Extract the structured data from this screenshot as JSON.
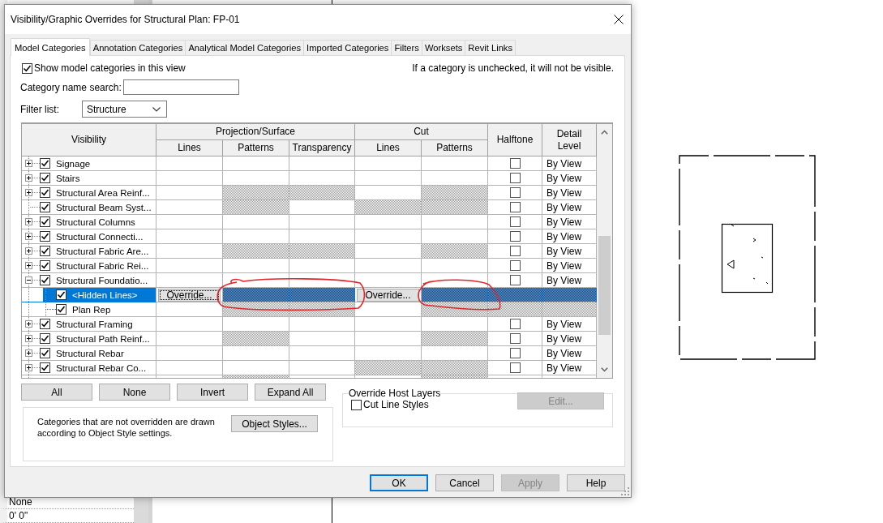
{
  "app": {
    "properties": [
      "None",
      "0' 0\""
    ]
  },
  "dialog": {
    "title": "Visibility/Graphic Overrides for Structural Plan: FP-01"
  },
  "tabs": [
    {
      "label": "Model Categories",
      "selected": true
    },
    {
      "label": "Annotation Categories",
      "selected": false
    },
    {
      "label": "Analytical Model Categories",
      "selected": false
    },
    {
      "label": "Imported Categories",
      "selected": false
    },
    {
      "label": "Filters",
      "selected": false
    },
    {
      "label": "Worksets",
      "selected": false
    },
    {
      "label": "Revit Links",
      "selected": false
    }
  ],
  "show_categories": {
    "label": "Show model categories in this view",
    "checked": true
  },
  "hint": "If a category is unchecked, it will not be visible.",
  "search": {
    "label": "Category name search:"
  },
  "filter_list": {
    "label": "Filter list:",
    "value": "Structure"
  },
  "table": {
    "visibility_header": "Visibility",
    "groups": [
      {
        "label": "Projection/Surface",
        "columns": [
          "Lines",
          "Patterns",
          "Transparency"
        ]
      },
      {
        "label": "Cut",
        "columns": [
          "Lines",
          "Patterns"
        ]
      }
    ],
    "halftone_header": "Halftone",
    "detail_header": "Detail Level",
    "rows": [
      {
        "name": "Signage",
        "checked": true,
        "expanded": false,
        "selected": false,
        "cells": [
          {
            "kind": "empty"
          },
          {
            "kind": "empty"
          },
          {
            "kind": "empty"
          },
          {
            "kind": "empty"
          },
          {
            "kind": "empty"
          }
        ],
        "halftone": {
          "kind": "checkbox",
          "checked": false
        },
        "detail": {
          "kind": "text",
          "text": "By View"
        }
      },
      {
        "name": "Stairs",
        "checked": true,
        "expanded": false,
        "selected": false,
        "cells": [
          {
            "kind": "empty"
          },
          {
            "kind": "empty"
          },
          {
            "kind": "empty"
          },
          {
            "kind": "empty"
          },
          {
            "kind": "empty"
          }
        ],
        "halftone": {
          "kind": "checkbox",
          "checked": false
        },
        "detail": {
          "kind": "text",
          "text": "By View"
        }
      },
      {
        "name": "Structural Area Reinf...",
        "checked": true,
        "expanded": false,
        "selected": false,
        "cells": [
          {
            "kind": "empty"
          },
          {
            "kind": "hatched"
          },
          {
            "kind": "hatched"
          },
          {
            "kind": "empty"
          },
          {
            "kind": "hatched"
          }
        ],
        "halftone": {
          "kind": "checkbox",
          "checked": false
        },
        "detail": {
          "kind": "text",
          "text": "By View"
        }
      },
      {
        "name": "Structural Beam Syst...",
        "checked": true,
        "selected": false,
        "cells": [
          {
            "kind": "empty"
          },
          {
            "kind": "hatched"
          },
          {
            "kind": "empty"
          },
          {
            "kind": "hatched"
          },
          {
            "kind": "hatched"
          }
        ],
        "halftone": {
          "kind": "checkbox",
          "checked": false
        },
        "detail": {
          "kind": "text",
          "text": "By View"
        }
      },
      {
        "name": "Structural Columns",
        "checked": true,
        "expanded": false,
        "selected": false,
        "cells": [
          {
            "kind": "empty"
          },
          {
            "kind": "empty"
          },
          {
            "kind": "empty"
          },
          {
            "kind": "empty"
          },
          {
            "kind": "empty"
          }
        ],
        "halftone": {
          "kind": "checkbox",
          "checked": false
        },
        "detail": {
          "kind": "text",
          "text": "By View"
        }
      },
      {
        "name": "Structural Connecti...",
        "checked": true,
        "expanded": false,
        "selected": false,
        "cells": [
          {
            "kind": "empty"
          },
          {
            "kind": "empty"
          },
          {
            "kind": "empty"
          },
          {
            "kind": "empty"
          },
          {
            "kind": "empty"
          }
        ],
        "halftone": {
          "kind": "checkbox",
          "checked": false
        },
        "detail": {
          "kind": "text",
          "text": "By View"
        }
      },
      {
        "name": "Structural Fabric Are...",
        "checked": true,
        "expanded": false,
        "selected": false,
        "cells": [
          {
            "kind": "empty"
          },
          {
            "kind": "hatched"
          },
          {
            "kind": "hatched"
          },
          {
            "kind": "empty"
          },
          {
            "kind": "hatched"
          }
        ],
        "halftone": {
          "kind": "checkbox",
          "checked": false
        },
        "detail": {
          "kind": "text",
          "text": "By View"
        }
      },
      {
        "name": "Structural Fabric Rei...",
        "checked": true,
        "expanded": false,
        "selected": false,
        "cells": [
          {
            "kind": "empty"
          },
          {
            "kind": "empty"
          },
          {
            "kind": "empty"
          },
          {
            "kind": "empty"
          },
          {
            "kind": "empty"
          }
        ],
        "halftone": {
          "kind": "checkbox",
          "checked": false
        },
        "detail": {
          "kind": "text",
          "text": "By View"
        }
      },
      {
        "name": "Structural Foundatio...",
        "checked": true,
        "expanded": true,
        "selected": false,
        "cells": [
          {
            "kind": "empty"
          },
          {
            "kind": "empty"
          },
          {
            "kind": "empty"
          },
          {
            "kind": "empty"
          },
          {
            "kind": "empty"
          }
        ],
        "halftone": {
          "kind": "checkbox",
          "checked": false
        },
        "detail": {
          "kind": "text",
          "text": "By View"
        },
        "children": [
          {
            "name": "<Hidden Lines>",
            "checked": true,
            "selected": true,
            "cells": [
              {
                "kind": "button",
                "label": "Override...",
                "focused": true
              },
              {
                "kind": "hatched"
              },
              {
                "kind": "hatched"
              },
              {
                "kind": "button",
                "label": "Override...",
                "focused": false
              },
              {
                "kind": "hatched"
              }
            ],
            "halftone": {
              "kind": "hatched"
            },
            "detail": {
              "kind": "hatched"
            }
          },
          {
            "name": "Plan Rep",
            "checked": true,
            "selected": false,
            "cells": [
              {
                "kind": "empty"
              },
              {
                "kind": "hatched"
              },
              {
                "kind": "hatched"
              },
              {
                "kind": "empty"
              },
              {
                "kind": "hatched"
              }
            ],
            "halftone": {
              "kind": "hatched"
            },
            "detail": {
              "kind": "hatched"
            }
          }
        ]
      },
      {
        "name": "Structural Framing",
        "checked": true,
        "expanded": false,
        "selected": false,
        "cells": [
          {
            "kind": "empty"
          },
          {
            "kind": "empty"
          },
          {
            "kind": "empty"
          },
          {
            "kind": "empty"
          },
          {
            "kind": "empty"
          }
        ],
        "halftone": {
          "kind": "checkbox",
          "checked": false
        },
        "detail": {
          "kind": "text",
          "text": "By View"
        }
      },
      {
        "name": "Structural Path Reinf...",
        "checked": true,
        "expanded": false,
        "selected": false,
        "cells": [
          {
            "kind": "empty"
          },
          {
            "kind": "hatched"
          },
          {
            "kind": "empty"
          },
          {
            "kind": "empty"
          },
          {
            "kind": "hatched"
          }
        ],
        "halftone": {
          "kind": "checkbox",
          "checked": false
        },
        "detail": {
          "kind": "text",
          "text": "By View"
        }
      },
      {
        "name": "Structural Rebar",
        "checked": true,
        "expanded": false,
        "selected": false,
        "cells": [
          {
            "kind": "empty"
          },
          {
            "kind": "empty"
          },
          {
            "kind": "empty"
          },
          {
            "kind": "empty"
          },
          {
            "kind": "empty"
          }
        ],
        "halftone": {
          "kind": "checkbox",
          "checked": false
        },
        "detail": {
          "kind": "text",
          "text": "By View"
        }
      },
      {
        "name": "Structural Rebar Co...",
        "checked": true,
        "expanded": false,
        "selected": false,
        "cells": [
          {
            "kind": "empty"
          },
          {
            "kind": "empty"
          },
          {
            "kind": "empty"
          },
          {
            "kind": "hatched"
          },
          {
            "kind": "hatched"
          }
        ],
        "halftone": {
          "kind": "checkbox",
          "checked": false
        },
        "detail": {
          "kind": "text",
          "text": "By View"
        }
      },
      {
        "selected": false,
        "cells": [
          {
            "kind": "empty"
          },
          {
            "kind": "hatched"
          },
          {
            "kind": "empty"
          },
          {
            "kind": "empty"
          },
          {
            "kind": "hatched"
          }
        ],
        "halftone": {
          "kind": "empty"
        },
        "detail": {
          "kind": "empty"
        }
      }
    ]
  },
  "tree_buttons": [
    "All",
    "None",
    "Invert",
    "Expand All"
  ],
  "note": {
    "text": "Categories that are not overridden are drawn according to Object Style settings.",
    "button": "Object Styles..."
  },
  "host_layers": {
    "title": "Override Host Layers",
    "checkbox": {
      "label": "Cut Line Styles",
      "checked": false
    },
    "button": {
      "label": "Edit...",
      "disabled": true
    }
  },
  "dialog_buttons": [
    {
      "label": "OK",
      "default": true,
      "disabled": false
    },
    {
      "label": "Cancel",
      "default": false,
      "disabled": false
    },
    {
      "label": "Apply",
      "default": false,
      "disabled": true
    },
    {
      "label": "Help",
      "default": false,
      "disabled": false
    }
  ]
}
